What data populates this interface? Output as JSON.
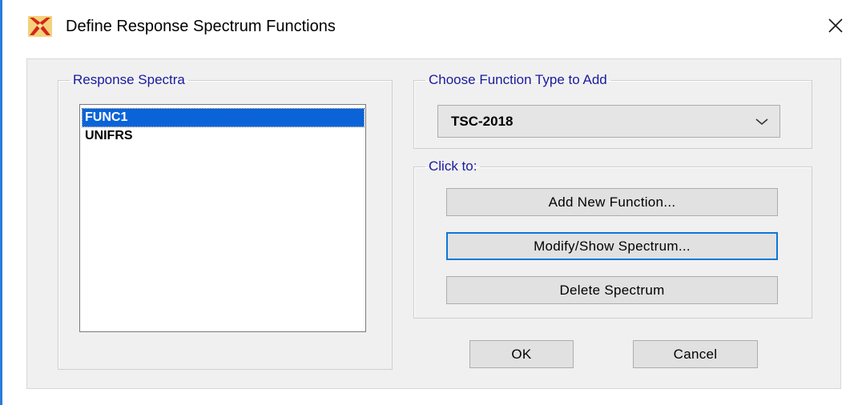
{
  "window": {
    "title": "Define Response Spectrum Functions",
    "app_icon": "etabs-x-icon",
    "close_icon": "close-icon"
  },
  "response_spectra": {
    "legend": "Response Spectra",
    "items": [
      "FUNC1",
      "UNIFRS"
    ],
    "selected": "FUNC1"
  },
  "function_type": {
    "legend": "Choose  Function Type to Add",
    "selected_value": "TSC-2018"
  },
  "click_to": {
    "legend": "Click to:",
    "add_new": "Add New Function...",
    "modify_show": "Modify/Show Spectrum...",
    "delete": "Delete Spectrum"
  },
  "footer": {
    "ok": "OK",
    "cancel": "Cancel"
  },
  "colors": {
    "selection": "#0a64d8",
    "legend_text": "#1a1a9e",
    "focus_border": "#0a78d7"
  }
}
